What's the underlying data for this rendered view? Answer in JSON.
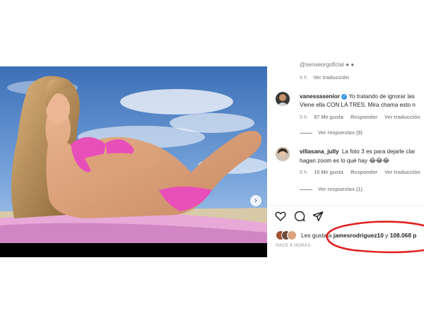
{
  "post": {
    "carousel_next": "›",
    "carousel_slides": 3,
    "carousel_active": 1
  },
  "comments": [
    {
      "text_partial": "@senseorgoficial ● ●",
      "time": "6 h",
      "reply": "Ver traducción"
    },
    {
      "username": "vanessasenior",
      "verified": true,
      "line1": "Yo tratando de ignorar las",
      "line2": "Viene ella CON LA TRES. Mira chama esto n",
      "time": "5 h",
      "likes": "87 Me gusta",
      "reply": "Responder",
      "translate": "Ver traducción",
      "replies": "Ver respuestas (9)"
    },
    {
      "username": "villasana_jully",
      "line1": "La foto 3 es para dejarle clar",
      "line2": "hagan zoom es lo qué hay 😂😂😂",
      "time": "5 h",
      "likes": "15 Me gusta",
      "reply": "Responder",
      "translate": "Ver traducción",
      "replies": "Ver respuestas (1)"
    }
  ],
  "actions": {
    "like_icon": "heart-icon",
    "comment_icon": "comment-icon",
    "share_icon": "share-icon"
  },
  "likes": {
    "prefix": "Les gusta a ",
    "user": "jamesrodriguez10",
    "middle": " y ",
    "count": "108.068 p"
  },
  "posted": "HACE 6 HORAS",
  "colors": {
    "verified": "#3797f0",
    "highlight_circle": "#e0201f",
    "muted_text": "#8e8e8e"
  }
}
